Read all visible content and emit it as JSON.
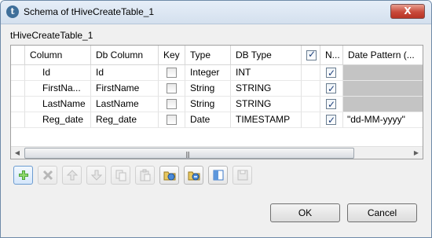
{
  "window": {
    "title": "Schema of tHiveCreateTable_1",
    "app_icon": "talend-logo-icon"
  },
  "close_button": "X",
  "component_name": "tHiveCreateTable_1",
  "table": {
    "headers": [
      "",
      "Column",
      "Db Column",
      "Key",
      "Type",
      "DB Type",
      "",
      "N...",
      "Date Pattern (..."
    ],
    "header_select_all_checked": true,
    "rows": [
      {
        "column": "Id",
        "db_column": "Id",
        "key": false,
        "type": "Integer",
        "db_type": "INT",
        "nullable": true,
        "date_pattern": "",
        "date_pattern_disabled": true
      },
      {
        "column": "FirstNa...",
        "db_column": "FirstName",
        "key": false,
        "type": "String",
        "db_type": "STRING",
        "nullable": true,
        "date_pattern": "",
        "date_pattern_disabled": true
      },
      {
        "column": "LastName",
        "db_column": "LastName",
        "key": false,
        "type": "String",
        "db_type": "STRING",
        "nullable": true,
        "date_pattern": "",
        "date_pattern_disabled": true
      },
      {
        "column": "Reg_date",
        "db_column": "Reg_date",
        "key": false,
        "type": "Date",
        "db_type": "TIMESTAMP",
        "nullable": true,
        "date_pattern": "\"dd-MM-yyyy\"",
        "date_pattern_disabled": false
      }
    ]
  },
  "toolbar": {
    "buttons": [
      {
        "name": "add-icon",
        "enabled": true
      },
      {
        "name": "remove-icon",
        "enabled": false
      },
      {
        "name": "move-up-icon",
        "enabled": false
      },
      {
        "name": "move-down-icon",
        "enabled": false
      },
      {
        "name": "copy-icon",
        "enabled": false
      },
      {
        "name": "paste-icon",
        "enabled": false
      },
      {
        "name": "import-schema-icon",
        "enabled": true
      },
      {
        "name": "export-schema-icon",
        "enabled": true
      },
      {
        "name": "columns-icon",
        "enabled": true
      },
      {
        "name": "save-icon",
        "enabled": false
      }
    ]
  },
  "buttons": {
    "ok": "OK",
    "cancel": "Cancel"
  },
  "colors": {
    "titlebar": "#d4e0ee",
    "disabled_cell": "#c4c4c4",
    "dialog_bg": "#f0f0f0",
    "close_red": "#c8493a"
  }
}
